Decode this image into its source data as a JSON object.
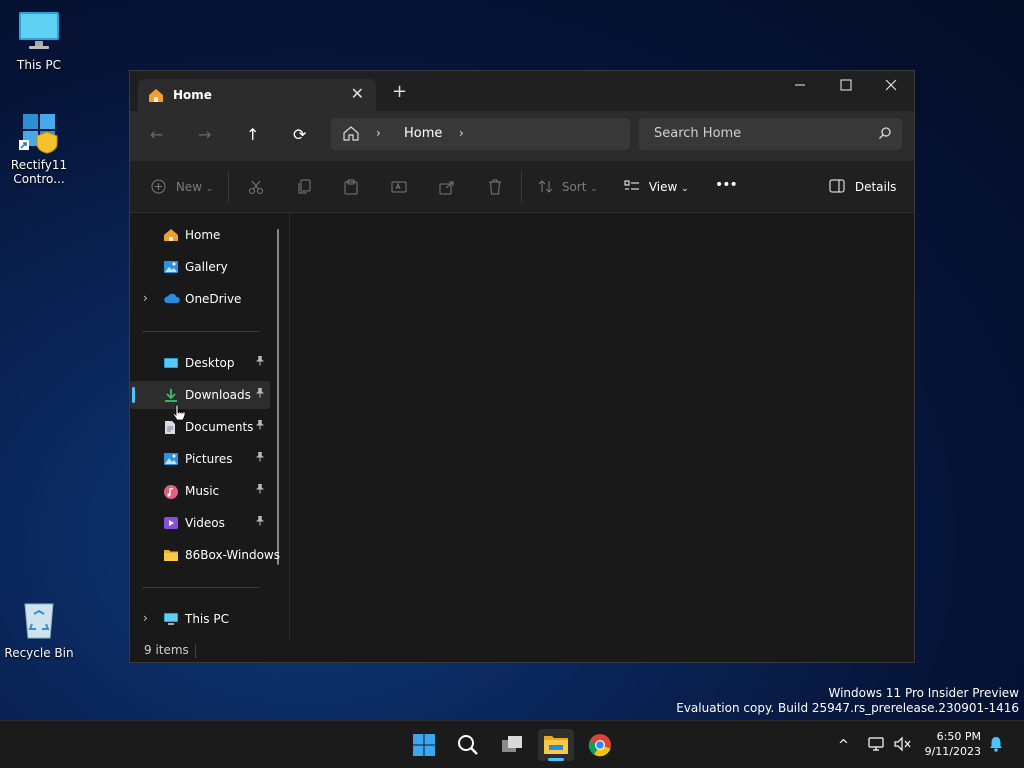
{
  "desktop": {
    "icons": [
      {
        "label": "This PC",
        "icon": "monitor-icon"
      },
      {
        "label": "Rectify11 Contro...",
        "icon": "control-panel-shortcut-icon"
      },
      {
        "label": "Recycle Bin",
        "icon": "recycle-bin-icon"
      }
    ],
    "watermark": {
      "line1": "Windows 11 Pro Insider Preview",
      "line2": "Evaluation copy. Build 25947.rs_prerelease.230901-1416"
    }
  },
  "explorer": {
    "tab": {
      "title": "Home",
      "close": "✕",
      "new_tab": "+"
    },
    "window_controls": {
      "minimize": "—",
      "maximize": "☐",
      "close": "✕"
    },
    "navigation": {
      "back": "←",
      "forward": "→",
      "up": "↑",
      "refresh": "⟳"
    },
    "address": {
      "segments": [
        "Home"
      ]
    },
    "search": {
      "placeholder": "Search Home"
    },
    "commands": {
      "new": "New",
      "sort": "Sort",
      "view": "View",
      "more": "•••",
      "details": "Details"
    },
    "sidebar": {
      "top": [
        {
          "label": "Home",
          "icon": "home-icon"
        },
        {
          "label": "Gallery",
          "icon": "gallery-icon"
        },
        {
          "label": "OneDrive",
          "icon": "onedrive-cloud-icon",
          "expandable": true
        }
      ],
      "quick_access": [
        {
          "label": "Desktop",
          "icon": "desktop-folder-icon",
          "pinned": true
        },
        {
          "label": "Downloads",
          "icon": "downloads-icon",
          "pinned": true,
          "selected": true
        },
        {
          "label": "Documents",
          "icon": "documents-icon",
          "pinned": true
        },
        {
          "label": "Pictures",
          "icon": "pictures-icon",
          "pinned": true
        },
        {
          "label": "Music",
          "icon": "music-icon",
          "pinned": true
        },
        {
          "label": "Videos",
          "icon": "videos-icon",
          "pinned": true
        },
        {
          "label": "86Box-Windows",
          "icon": "folder-icon",
          "pinned": false
        }
      ],
      "bottom": [
        {
          "label": "This PC",
          "icon": "monitor-icon",
          "expandable": true
        }
      ]
    },
    "status": {
      "items": "9 items"
    }
  },
  "taskbar": {
    "apps": [
      "start-icon",
      "search-icon",
      "task-view-icon",
      "file-explorer-icon",
      "chrome-icon"
    ],
    "tray": {
      "chevron": "^"
    },
    "clock": {
      "time": "6:50 PM",
      "date": "9/11/2023"
    }
  },
  "colors": {
    "accent": "#4cc2ff",
    "window_bg": "#191919",
    "titlebar": "#202020"
  }
}
